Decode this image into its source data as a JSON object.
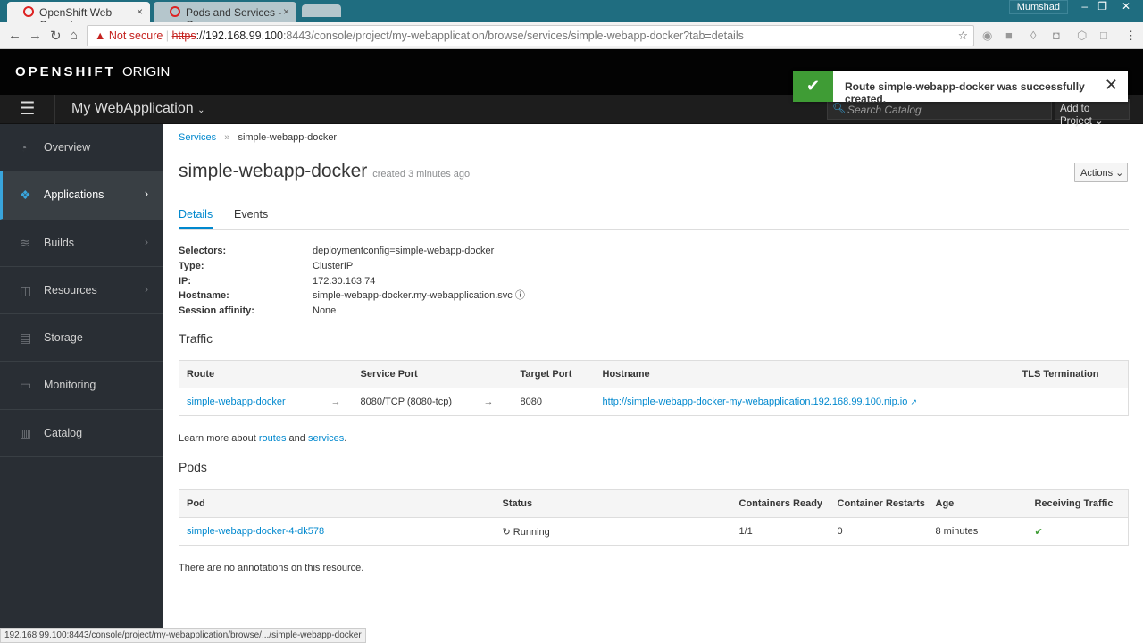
{
  "browser": {
    "tabs": [
      {
        "label": "OpenShift Web Console"
      },
      {
        "label": "Pods and Services - Core"
      }
    ],
    "user": "Mumshad",
    "not_secure": "Not secure",
    "url_scheme": "https",
    "url_host": "://192.168.99.100",
    "url_rest": ":8443/console/project/my-webapplication/browse/services/simple-webapp-docker?tab=details",
    "status_url": "192.168.99.100:8443/console/project/my-webapplication/browse/.../simple-webapp-docker"
  },
  "header": {
    "brand_bold": "OPENSHIFT",
    "brand_light": "ORIGIN",
    "project": "My WebApplication",
    "search_placeholder": "Search Catalog",
    "add_to_project": "Add to Project"
  },
  "toast": {
    "message": "Route simple-webapp-docker was successfully created."
  },
  "sidebar": {
    "items": [
      {
        "label": "Overview",
        "icon": "dashboard-icon"
      },
      {
        "label": "Applications",
        "icon": "cubes-icon"
      },
      {
        "label": "Builds",
        "icon": "layers-icon"
      },
      {
        "label": "Resources",
        "icon": "resources-icon"
      },
      {
        "label": "Storage",
        "icon": "database-icon"
      },
      {
        "label": "Monitoring",
        "icon": "monitor-icon"
      },
      {
        "label": "Catalog",
        "icon": "book-icon"
      }
    ]
  },
  "main": {
    "breadcrumb": {
      "parent": "Services",
      "current": "simple-webapp-docker"
    },
    "title": "simple-webapp-docker",
    "created": "created 3 minutes ago",
    "actions": "Actions",
    "tabs": [
      "Details",
      "Events"
    ],
    "details": [
      {
        "k": "Selectors:",
        "v": "deploymentconfig=simple-webapp-docker"
      },
      {
        "k": "Type:",
        "v": "ClusterIP"
      },
      {
        "k": "IP:",
        "v": "172.30.163.74"
      },
      {
        "k": "Hostname:",
        "v": "simple-webapp-docker.my-webapplication.svc"
      },
      {
        "k": "Session affinity:",
        "v": "None"
      }
    ],
    "traffic": {
      "heading": "Traffic",
      "headers": [
        "Route",
        "Service Port",
        "Target Port",
        "Hostname",
        "TLS Termination"
      ],
      "row": {
        "route": "simple-webapp-docker",
        "arrow": "→",
        "service_port": "8080/TCP (8080-tcp)",
        "target_port": "8080",
        "hostname": "http://simple-webapp-docker-my-webapplication.192.168.99.100.nip.io",
        "tls": ""
      }
    },
    "learn": {
      "pre": "Learn more about ",
      "routes": "routes",
      "and": " and ",
      "services": "services",
      "post": "."
    },
    "pods": {
      "heading": "Pods",
      "headers": [
        "Pod",
        "Status",
        "Containers Ready",
        "Container Restarts",
        "Age",
        "Receiving Traffic"
      ],
      "row": {
        "pod": "simple-webapp-docker-4-dk578",
        "status": "Running",
        "ready": "1/1",
        "restarts": "0",
        "age": "8 minutes",
        "traffic": "✔"
      }
    },
    "annotations": "There are no annotations on this resource."
  }
}
